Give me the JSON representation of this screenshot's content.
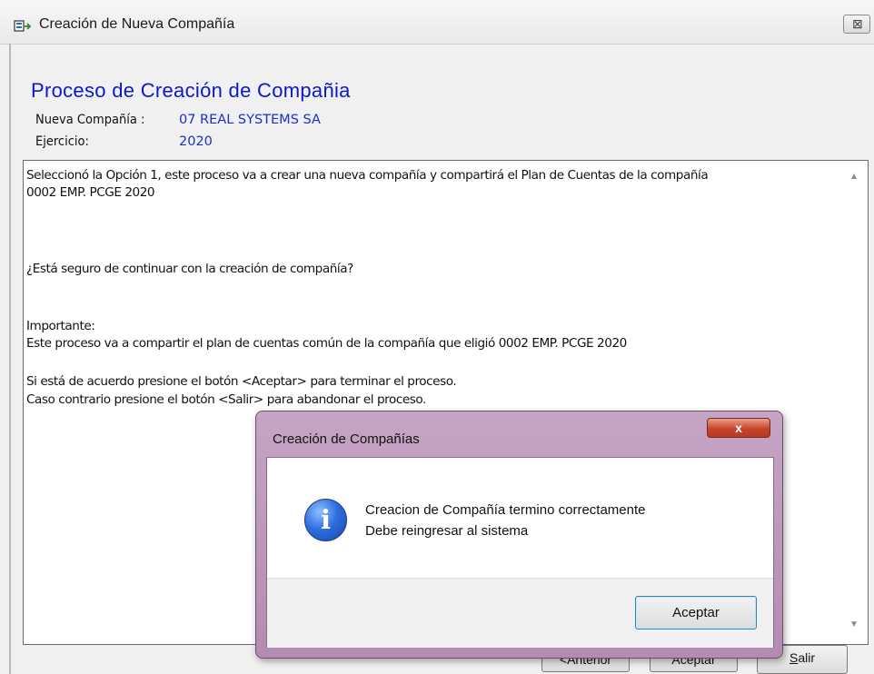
{
  "window": {
    "title": "Creación de Nueva Compañía",
    "close_label": "⊠"
  },
  "header": {
    "heading": "Proceso de Creación de Compañia",
    "company_label": "Nueva Compañía :",
    "company_value": "07 REAL SYSTEMS SA",
    "year_label": "Ejercicio:",
    "year_value": "2020"
  },
  "message": {
    "lines": [
      "Seleccionó la Opción 1, este proceso va a crear una nueva compañía y compartirá el Plan de Cuentas de la compañía",
      "0002 EMP. PCGE 2020",
      "¿Está seguro de continuar con la creación de compañía?",
      "Importante:",
      "Este proceso va a compartir el plan de cuentas común de la compañía que eligió 0002 EMP. PCGE 2020",
      "Si está de acuerdo presione el botón <Aceptar> para terminar el proceso.",
      "Caso contrario presione el botón <Salir> para abandonar el proceso."
    ]
  },
  "buttons": {
    "anterior": "<Anterior",
    "aceptar": "Aceptar",
    "salir_underlined": "S",
    "salir_rest": "alir"
  },
  "dialog": {
    "title": "Creación de Compañías",
    "close_label": "x",
    "icon": "info-icon",
    "line1": "Creacion de Compañía termino correctamente",
    "line2": "Debe reingresar al sistema",
    "ok_label": "Aceptar"
  },
  "colors": {
    "heading_blue": "#0b19c9",
    "dialog_frame": "#b48bb1",
    "close_red": "#c8442a"
  }
}
